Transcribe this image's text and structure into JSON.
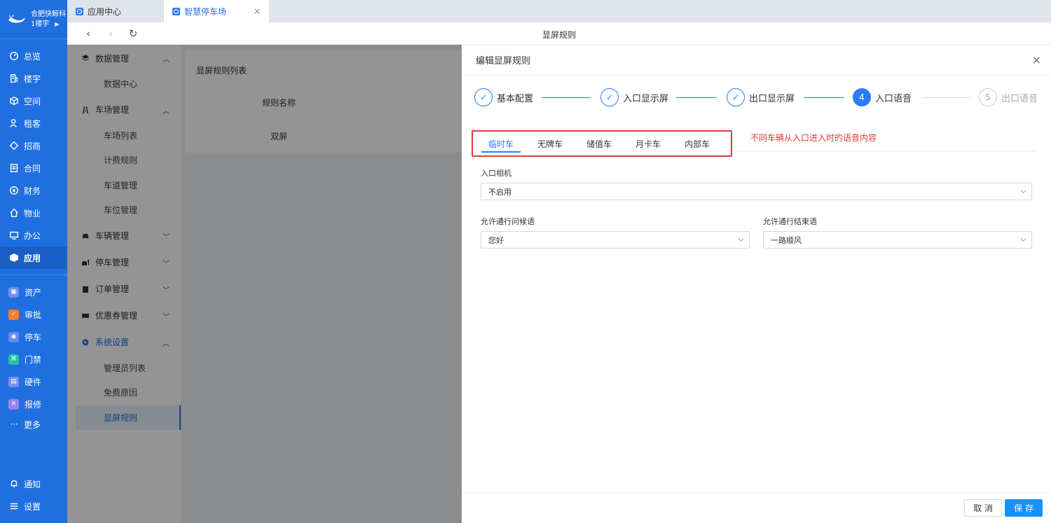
{
  "brand": {
    "name": "合肥快鲸科",
    "building": "1楼宇"
  },
  "rail": {
    "items": [
      {
        "label": "总览",
        "icon": "dashboard-icon"
      },
      {
        "label": "楼宇",
        "icon": "building-icon"
      },
      {
        "label": "空间",
        "icon": "cube-icon"
      },
      {
        "label": "租客",
        "icon": "users-icon"
      },
      {
        "label": "招商",
        "icon": "tag-icon"
      },
      {
        "label": "合同",
        "icon": "document-icon"
      },
      {
        "label": "财务",
        "icon": "coin-icon"
      },
      {
        "label": "物业",
        "icon": "home-icon"
      },
      {
        "label": "办公",
        "icon": "monitor-icon"
      },
      {
        "label": "应用",
        "icon": "app-icon"
      }
    ],
    "apps": [
      {
        "label": "资产",
        "color": "#6f8fe8"
      },
      {
        "label": "审批",
        "color": "#f57e2a"
      },
      {
        "label": "停车",
        "color": "#5a8df5"
      },
      {
        "label": "门禁",
        "color": "#1fc4a6"
      },
      {
        "label": "硬件",
        "color": "#7b8ef0"
      },
      {
        "label": "报修",
        "color": "#9b82f0"
      }
    ],
    "more": "更多",
    "bottom": [
      {
        "label": "通知",
        "icon": "bell-icon"
      },
      {
        "label": "设置",
        "icon": "menu-icon"
      }
    ]
  },
  "tabs": [
    {
      "label": "应用中心"
    },
    {
      "label": "智慧停车场",
      "close": "×"
    }
  ],
  "navbar": {
    "title": "显屏规则",
    "back": "‹",
    "forward": "›",
    "refresh": "↻"
  },
  "submenu": {
    "g1": {
      "label": "数据管理"
    },
    "g1_items": [
      "数据中心"
    ],
    "g2": {
      "label": "车场管理"
    },
    "g2_items": [
      "车场列表",
      "计费规则",
      "车道管理",
      "车位管理"
    ],
    "g3": {
      "label": "车辆管理"
    },
    "g4": {
      "label": "停车管理"
    },
    "g5": {
      "label": "订单管理"
    },
    "g6": {
      "label": "优惠券管理"
    },
    "g7": {
      "label": "系统设置"
    },
    "g7_items": [
      "管理员列表",
      "免费原因",
      "显屏规则"
    ]
  },
  "card": {
    "title": "显屏规则列表",
    "col_name": "规则名称",
    "row_value": "双屏"
  },
  "drawer": {
    "title": "编辑显屏规则",
    "close": "×",
    "steps": [
      {
        "num": "1",
        "label": "基本配置",
        "status": "done"
      },
      {
        "num": "2",
        "label": "入口显示屏",
        "status": "done"
      },
      {
        "num": "3",
        "label": "出口显示屏",
        "status": "done"
      },
      {
        "num": "4",
        "label": "入口语音",
        "status": "current"
      },
      {
        "num": "5",
        "label": "出口语音",
        "status": "wait"
      }
    ],
    "vehicle_tabs": [
      "临时车",
      "无牌车",
      "储值车",
      "月卡车",
      "内部车"
    ],
    "note": "不同车辆从入口进入时的语音内容",
    "camera_label": "入口相机",
    "camera_value": "不启用",
    "greeting_label": "允许通行问候语",
    "greeting_value": "您好",
    "ending_label": "允许通行结束语",
    "ending_value": "一路顺风",
    "cancel": "取 消",
    "save": "保 存"
  }
}
